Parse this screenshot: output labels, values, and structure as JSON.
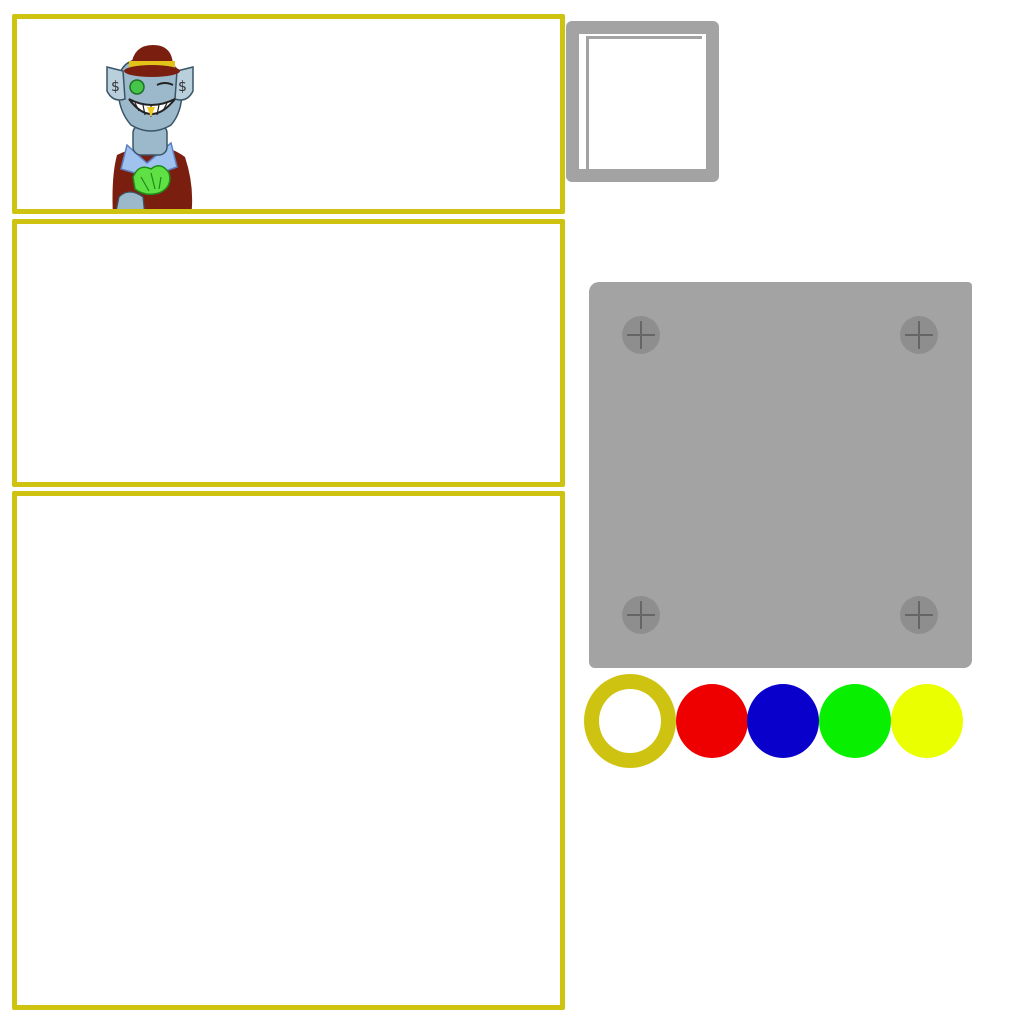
{
  "panels": [
    {
      "id": "top",
      "has_character": true
    },
    {
      "id": "middle",
      "has_character": false
    },
    {
      "id": "bottom",
      "has_character": false
    }
  ],
  "character": {
    "icon": "rich-creature-with-hat-and-money",
    "ear_symbol": "$"
  },
  "palette": {
    "selected": "white",
    "colors": [
      {
        "name": "white",
        "hex": "#ffffff"
      },
      {
        "name": "red",
        "hex": "#ee0000"
      },
      {
        "name": "blue",
        "hex": "#0a00cc"
      },
      {
        "name": "green",
        "hex": "#08f000"
      },
      {
        "name": "yellow",
        "hex": "#eaff00"
      }
    ]
  },
  "accent_color": "#cfc311",
  "plate_color": "#a3a3a3"
}
